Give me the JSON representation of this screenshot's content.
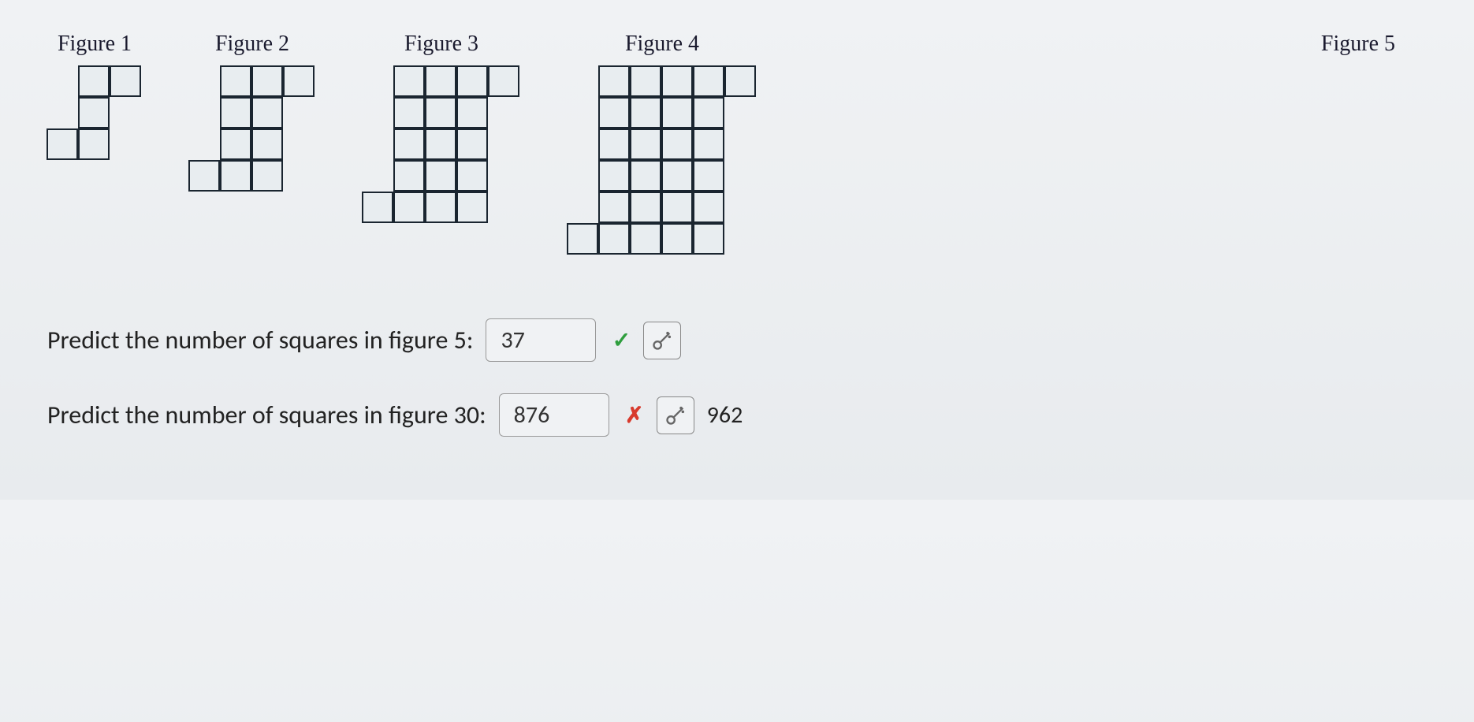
{
  "figures": {
    "labels": [
      "Figure 1",
      "Figure 2",
      "Figure 3",
      "Figure 4",
      "Figure 5"
    ]
  },
  "questions": [
    {
      "prompt": "Predict the number of squares in figure 5:",
      "answer": "37",
      "status": "correct",
      "correct_value": null
    },
    {
      "prompt": "Predict the number of squares in figure 30:",
      "answer": "876",
      "status": "incorrect",
      "correct_value": "962"
    }
  ]
}
